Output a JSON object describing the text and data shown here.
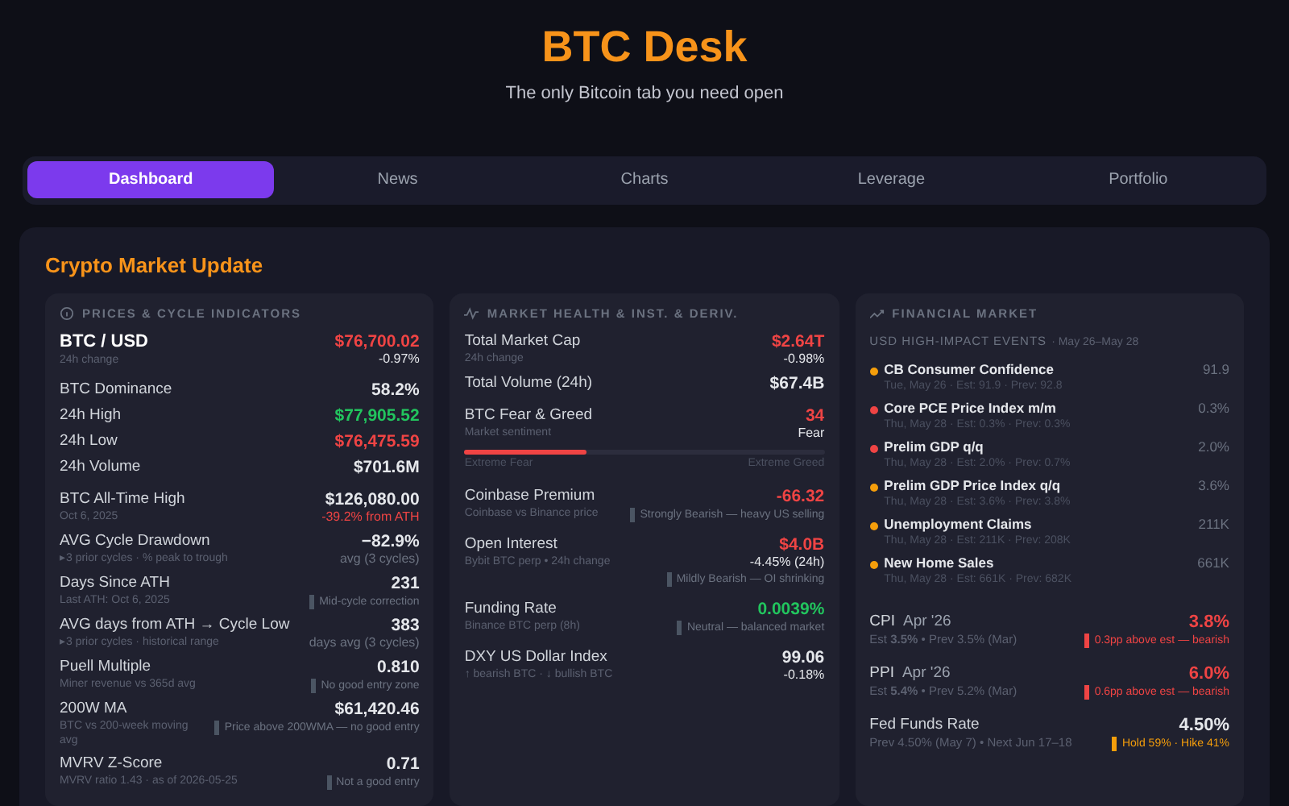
{
  "header": {
    "title": "BTC Desk",
    "subtitle": "The only Bitcoin tab you need open"
  },
  "tabs": [
    {
      "label": "Dashboard",
      "selected": true
    },
    {
      "label": "News",
      "selected": false
    },
    {
      "label": "Charts",
      "selected": false
    },
    {
      "label": "Leverage",
      "selected": false
    },
    {
      "label": "Portfolio",
      "selected": false
    }
  ],
  "section_title": "Crypto Market Update",
  "cards": [
    {
      "kind": "metrics",
      "title": "PRICES & CYCLE INDICATORS",
      "groups": [
        [
          {
            "label": "BTC / USD",
            "headline": true,
            "sub": "24h change",
            "value": {
              "text": "$76,700.02",
              "color": "#ef4444"
            },
            "value2": {
              "text": "-0.97%"
            }
          }
        ],
        [
          {
            "label": "BTC Dominance",
            "headline": false,
            "value": {
              "text": "58.2%"
            }
          },
          {
            "label": "24h High",
            "headline": false,
            "value": {
              "text": "$77,905.52",
              "color": "#22c55e"
            }
          },
          {
            "label": "24h Low",
            "headline": false,
            "value": {
              "text": "$76,475.59",
              "color": "#ef4444"
            }
          },
          {
            "label": "24h Volume",
            "headline": false,
            "value": {
              "text": "$701.6M"
            }
          }
        ],
        [
          {
            "label": "BTC All-Time High",
            "headline": false,
            "sub": "Oct 6, 2025",
            "value": {
              "text": "$126,080.00"
            },
            "value2": {
              "text": "-39.2% from ATH",
              "color": "#ef4444"
            }
          },
          {
            "label": "AVG Cycle Drawdown",
            "headline": false,
            "sub": "▸3 prior cycles · % peak to trough",
            "value": {
              "text": "−82.9%"
            },
            "value2": {
              "text": "avg (3 cycles)",
              "color": "#6b7280"
            }
          },
          {
            "label": "Days Since ATH",
            "headline": false,
            "sub": "Last ATH: Oct 6, 2025",
            "value": {
              "text": "231"
            },
            "note": {
              "text": "Mid-cycle correction",
              "color": "#4b5563"
            }
          },
          {
            "label": "AVG days from ATH → Cycle Low",
            "headline": false,
            "sub": "▸3 prior cycles · historical range",
            "value": {
              "text": "383"
            },
            "value2": {
              "text": "days avg (3 cycles)",
              "color": "#6b7280"
            }
          },
          {
            "label": "Puell Multiple",
            "headline": false,
            "sub": "Miner revenue vs 365d avg",
            "value": {
              "text": "0.810"
            },
            "note": {
              "text": "No good entry zone",
              "color": "#4b5563"
            }
          },
          {
            "label": "200W MA",
            "headline": false,
            "sub": "BTC vs 200-week moving avg",
            "value": {
              "text": "$61,420.46"
            },
            "note": {
              "text": "Price above 200WMA — no good entry",
              "color": "#4b5563"
            }
          },
          {
            "label": "MVRV Z-Score",
            "headline": false,
            "sub": "MVRV ratio 1.43 · as of 2026-05-25",
            "value": {
              "text": "0.71"
            },
            "note": {
              "text": "Not a good entry",
              "color": "#4b5563"
            }
          }
        ]
      ]
    },
    {
      "kind": "metrics",
      "title": "MARKET HEALTH & INST. & DERIV.",
      "groups": [
        [
          {
            "label": "Total Market Cap",
            "headline": false,
            "sub": "24h change",
            "value": {
              "text": "$2.64T",
              "color": "#ef4444"
            },
            "value2": {
              "text": "-0.98%"
            }
          },
          {
            "label": "Total Volume (24h)",
            "headline": false,
            "value": {
              "text": "$67.4B"
            }
          }
        ],
        [
          {
            "label": "BTC Fear & Greed",
            "headline": false,
            "sub": "Market sentiment",
            "value": {
              "text": "34",
              "color": "#ef4444"
            },
            "value2": {
              "text": "Fear"
            },
            "gauge": {
              "level": 0.34,
              "min_label": "Extreme Fear",
              "max_label": "Extreme Greed"
            }
          }
        ],
        [
          {
            "label": "Coinbase Premium",
            "headline": false,
            "sub": "Coinbase vs Binance price",
            "value": {
              "text": "-66.32",
              "color": "#ef4444"
            },
            "note": {
              "text": "Strongly Bearish — heavy US selling",
              "color": "#4b5563"
            }
          }
        ],
        [
          {
            "label": "Open Interest",
            "headline": false,
            "sub": "Bybit BTC perp • 24h change",
            "value": {
              "text": "$4.0B",
              "color": "#ef4444"
            },
            "value2": {
              "text": "-4.45% (24h)"
            },
            "note": {
              "text": "Mildly Bearish — OI shrinking",
              "color": "#4b5563"
            }
          }
        ],
        [
          {
            "label": "Funding Rate",
            "headline": false,
            "sub": "Binance BTC perp (8h)",
            "value": {
              "text": "0.0039%",
              "color": "#22c55e"
            },
            "note": {
              "text": "Neutral — balanced market",
              "color": "#4b5563"
            }
          }
        ],
        [
          {
            "label": "DXY US Dollar Index",
            "headline": false,
            "sub": "↑ bearish BTC · ↓ bullish BTC",
            "value": {
              "text": "99.06"
            },
            "value2": {
              "text": "-0.18%"
            }
          }
        ]
      ]
    },
    {
      "kind": "macro",
      "title": "FINANCIAL MARKET",
      "events_title": "USD HIGH-IMPACT EVENTS",
      "events_range": "· May 26–May 28",
      "events": [
        {
          "name": "CB Consumer Confidence",
          "detail": "Tue, May 26 · Est: 91.9 · Prev: 92.8",
          "value": "91.9",
          "color": "#f59e0b"
        },
        {
          "name": "Core PCE Price Index m/m",
          "detail": "Thu, May 28 · Est: 0.3% · Prev: 0.3%",
          "value": "0.3%",
          "color": "#ef4444"
        },
        {
          "name": "Prelim GDP q/q",
          "detail": "Thu, May 28 · Est: 2.0% · Prev: 0.7%",
          "value": "2.0%",
          "color": "#ef4444"
        },
        {
          "name": "Prelim GDP Price Index q/q",
          "detail": "Thu, May 28 · Est: 3.6% · Prev: 3.8%",
          "value": "3.6%",
          "color": "#f59e0b"
        },
        {
          "name": "Unemployment Claims",
          "detail": "Thu, May 28 · Est: 211K · Prev: 208K",
          "value": "211K",
          "color": "#f59e0b"
        },
        {
          "name": "New Home Sales",
          "detail": "Thu, May 28 · Est: 661K · Prev: 682K",
          "value": "661K",
          "color": "#f59e0b"
        }
      ],
      "indicators": [
        {
          "label": "CPI",
          "period": "Apr '26",
          "detail": "Est **3.5%** • Prev 3.5% (Mar)",
          "value": {
            "text": "3.8%",
            "color": "#ef4444"
          },
          "note": {
            "text": "0.3pp above est — bearish",
            "color": "#ef4444"
          }
        },
        {
          "label": "PPI",
          "period": "Apr '26",
          "detail": "Est **5.4%** • Prev 5.2% (Mar)",
          "value": {
            "text": "6.0%",
            "color": "#ef4444"
          },
          "note": {
            "text": "0.6pp above est — bearish",
            "color": "#ef4444"
          }
        },
        {
          "label": "Fed Funds Rate",
          "detail": "Prev 4.50% (May 7) • Next Jun 17–18",
          "value": {
            "text": "4.50%"
          },
          "note": {
            "text": "Hold 59% · Hike 41%",
            "color": "#f59e0b"
          }
        }
      ]
    }
  ]
}
